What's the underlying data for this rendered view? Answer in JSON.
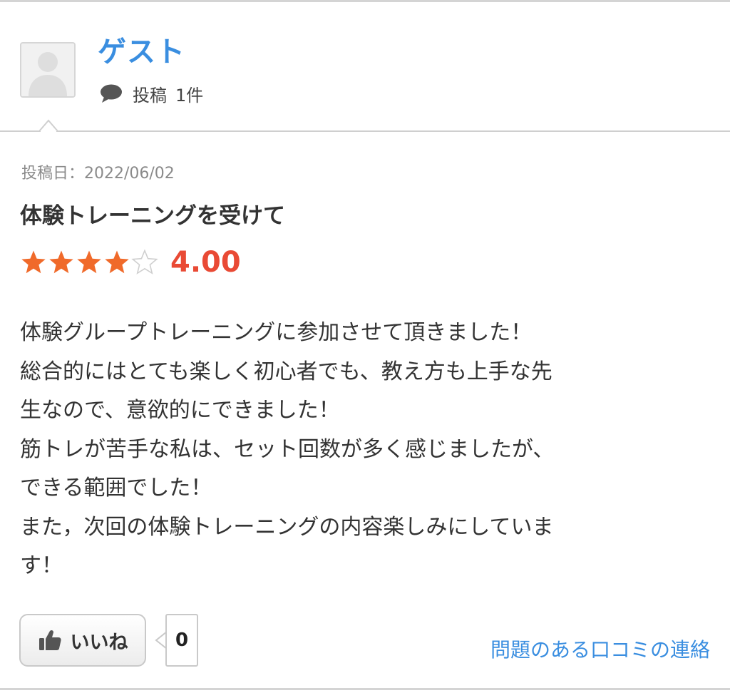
{
  "user": {
    "name": "ゲスト",
    "post_label": "投稿",
    "post_count": "1件"
  },
  "review": {
    "date": "投稿日：2022/06/02",
    "title": "体験トレーニングを受けて",
    "rating": {
      "stars_filled": 4,
      "stars_total": 5,
      "value": "4.00"
    },
    "body_lines": [
      "体験グループトレーニングに参加させて頂きました！",
      "総合的にはとても楽しく初心者でも、教え方も上手な先",
      "生なので、意欲的にできました！",
      "筋トレが苦手な私は、セット回数が多く感じましたが、",
      "できる範囲でした！",
      "また，次回の体験トレーニングの内容楽しみにしていま",
      "す！"
    ]
  },
  "footer": {
    "like_label": "いいね",
    "like_count": "0",
    "report_label": "問題のある口コミの連絡"
  },
  "colors": {
    "accent_blue": "#3a8ee0",
    "star_orange": "#f06a2a",
    "rating_red": "#e94a35"
  },
  "icons": {
    "avatar": "user-silhouette-icon",
    "post": "speech-bubble-icon",
    "like": "thumbs-up-icon",
    "star": "star-icon"
  }
}
